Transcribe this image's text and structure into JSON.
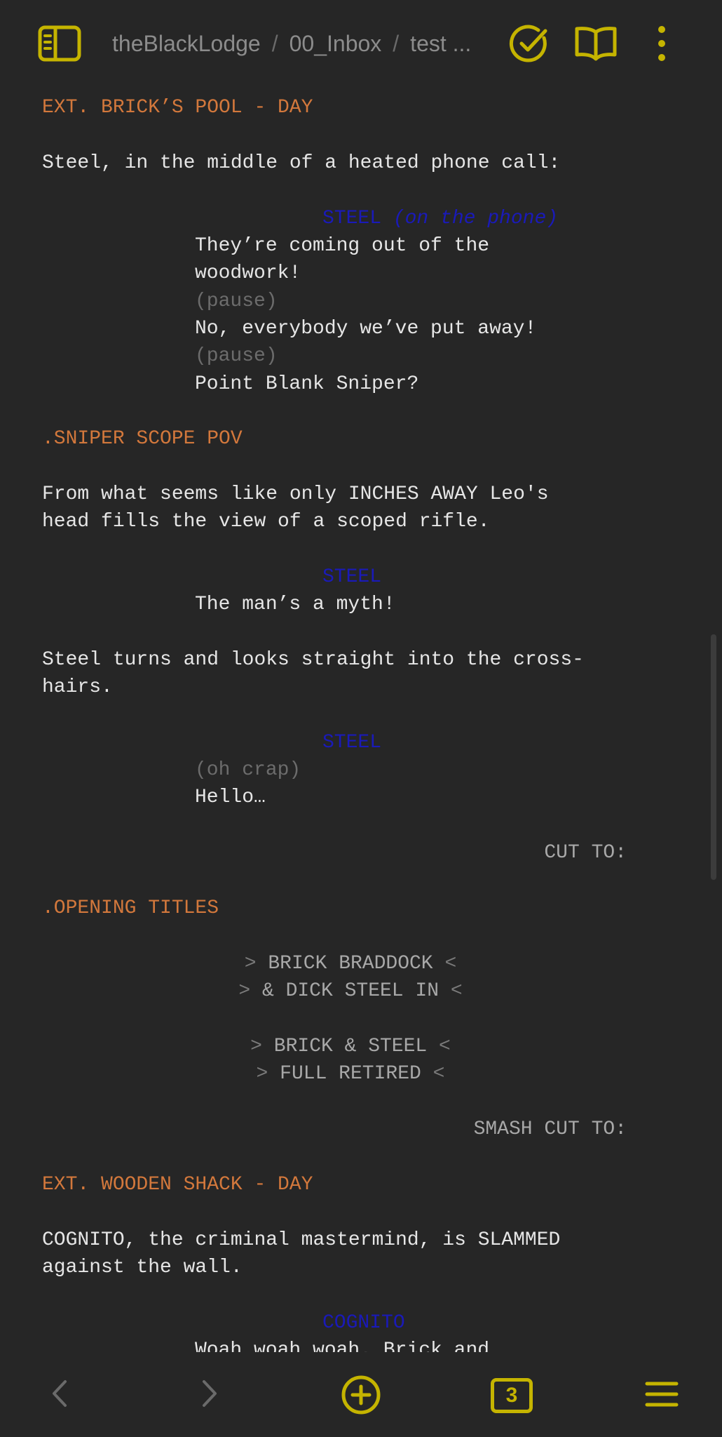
{
  "header": {
    "breadcrumb": {
      "vault": "theBlackLodge",
      "folder": "00_Inbox",
      "file": "test ..."
    },
    "separator": "/",
    "icons": {
      "sidebar_toggle": "sidebar-toggle-icon",
      "sync": "sync-check-icon",
      "reading_mode": "open-book-icon",
      "more": "more-vertical-icon"
    },
    "accent_color": "#c5b400"
  },
  "screenplay": {
    "scene1_heading": "EXT. BRICK’S POOL - DAY",
    "scene1_action": "Steel, in the middle of a heated phone call:",
    "char1_name": "STEEL",
    "char1_ext": "(on the phone)",
    "dlg1_line1": "They’re coming out of the",
    "dlg1_line2": "woodwork!",
    "paren1": "(pause)",
    "dlg1_line3": "No, everybody we’ve put away!",
    "paren2": "(pause)",
    "dlg1_line4": "Point Blank Sniper?",
    "section1": ".SNIPER SCOPE POV",
    "action2_line1": "From what seems like only INCHES AWAY Leo's",
    "action2_line2": "head fills the view of a scoped rifle.",
    "char2_name": "STEEL",
    "dlg2_line1": "The man’s a myth!",
    "action3_line1": "Steel turns and looks straight into the cross-",
    "action3_line2": "hairs.",
    "char3_name": "STEEL",
    "paren3": "(oh crap)",
    "dlg3_line1": "Hello…",
    "transition1": "CUT TO:",
    "section2": ".OPENING TITLES",
    "centered": [
      {
        "open": ">",
        "text": "BRICK BRADDOCK",
        "close": "<"
      },
      {
        "open": ">",
        "text": "& DICK STEEL IN",
        "close": "<"
      },
      {
        "open": ">",
        "text": "BRICK & STEEL",
        "close": "<"
      },
      {
        "open": ">",
        "text": "FULL RETIRED",
        "close": "<"
      }
    ],
    "transition2": "SMASH CUT TO:",
    "scene2_heading": "EXT. WOODEN SHACK - DAY",
    "action4_line1": "COGNITO, the criminal mastermind, is SLAMMED",
    "action4_line2": "against the wall.",
    "char4_name": "COGNITO",
    "dlg4_line1": "Woah woah woah. Brick and"
  },
  "footer": {
    "tab_count": "3",
    "icons": {
      "back": "chevron-left-icon",
      "forward": "chevron-right-icon",
      "new_note": "plus-circle-icon",
      "tabs": "tabs-count-icon",
      "menu": "hamburger-menu-icon"
    }
  }
}
